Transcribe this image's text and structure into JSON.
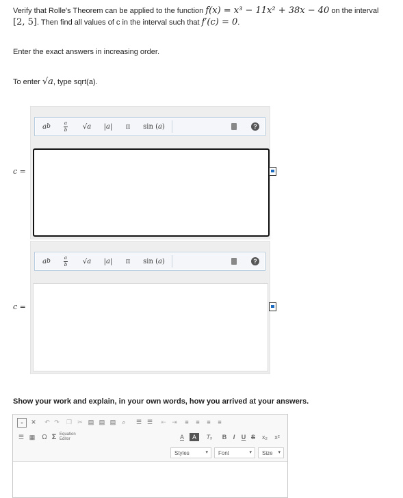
{
  "problem": {
    "verify_prefix": "Verify that Rolle's Theorem can be applied to the function",
    "function_expr": "f(x) = x³ − 11x² + 38x − 40",
    "on_interval_text": "on the interval",
    "interval": "[2, 5]",
    "then_text": ". Then find all values of c in the interval such that",
    "condition": "f′(c) = 0",
    "period": "."
  },
  "instructions": {
    "order": "Enter the exact answers in increasing order.",
    "sqrt_prefix": "To enter",
    "sqrt_symbol": "√a",
    "sqrt_suffix": ", type sqrt(a)."
  },
  "math_toolbar": {
    "buttons": [
      {
        "name": "power",
        "label": "a^b"
      },
      {
        "name": "fraction",
        "label": "a/b"
      },
      {
        "name": "sqrt",
        "label": "√a"
      },
      {
        "name": "abs",
        "label": "|a|"
      },
      {
        "name": "pi",
        "label": "π"
      },
      {
        "name": "sin",
        "label": "sin (a)"
      }
    ]
  },
  "answers": [
    {
      "label": "c =",
      "value": ""
    },
    {
      "label": "c =",
      "value": ""
    }
  ],
  "work": {
    "prompt": "Show your work and explain, in your own words, how you arrived at your answers.",
    "equation_editor": "Equation Editor",
    "format_buttons": [
      "B",
      "I",
      "U",
      "S",
      "x₂",
      "x²"
    ],
    "styles": "Styles",
    "font": "Font",
    "size": "Size"
  },
  "colors": {
    "toolbar_border": "#b9cde0",
    "answer_border_active": "#111111",
    "panel_bg": "#eeeeee"
  }
}
